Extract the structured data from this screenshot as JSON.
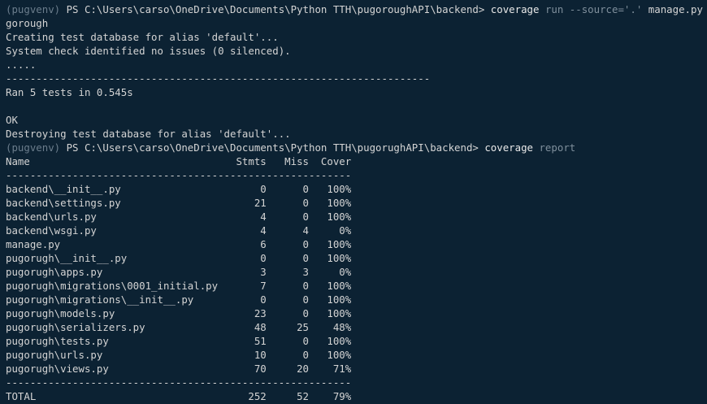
{
  "terminal": {
    "colors": {
      "background": "#0c2233",
      "text": "#d4d4d4",
      "venv": "#6b7d8c",
      "command": "#e8e8e8",
      "argument": "#7f8f9c"
    },
    "prompt1": {
      "venv": "(pugvenv)",
      "path": " PS C:\\Users\\carso\\OneDrive\\Documents\\Python TTH\\pugoroughAPI\\backend> ",
      "command": "coverage",
      "arg1": " run ",
      "arg2": "--source='.'",
      "rest": " manage.py test pu",
      "wrap": "gorough"
    },
    "test_output": [
      "Creating test database for alias 'default'...",
      "System check identified no issues (0 silenced).",
      ".....",
      "----------------------------------------------------------------------",
      "Ran 5 tests in 0.545s",
      "",
      "OK",
      "Destroying test database for alias 'default'..."
    ],
    "prompt2": {
      "venv": "(pugvenv)",
      "path": " PS C:\\Users\\carso\\OneDrive\\Documents\\Python TTH\\pugorughAPI\\backend> ",
      "command": "coverage",
      "arg1": " report"
    },
    "report": {
      "header": "Name                                  Stmts   Miss  Cover",
      "separator": "---------------------------------------------------------",
      "rows": [
        "backend\\__init__.py                       0      0   100%",
        "backend\\settings.py                      21      0   100%",
        "backend\\urls.py                           4      0   100%",
        "backend\\wsgi.py                           4      4     0%",
        "manage.py                                 6      0   100%",
        "pugorugh\\__init__.py                      0      0   100%",
        "pugorugh\\apps.py                          3      3     0%",
        "pugorugh\\migrations\\0001_initial.py       7      0   100%",
        "pugorugh\\migrations\\__init__.py           0      0   100%",
        "pugorugh\\models.py                       23      0   100%",
        "pugorugh\\serializers.py                  48     25    48%",
        "pugorugh\\tests.py                        51      0   100%",
        "pugorugh\\urls.py                         10      0   100%",
        "pugorugh\\views.py                        70     20    71%"
      ],
      "total_separator": "---------------------------------------------------------",
      "total": "TOTAL                                   252     52    79%"
    }
  }
}
